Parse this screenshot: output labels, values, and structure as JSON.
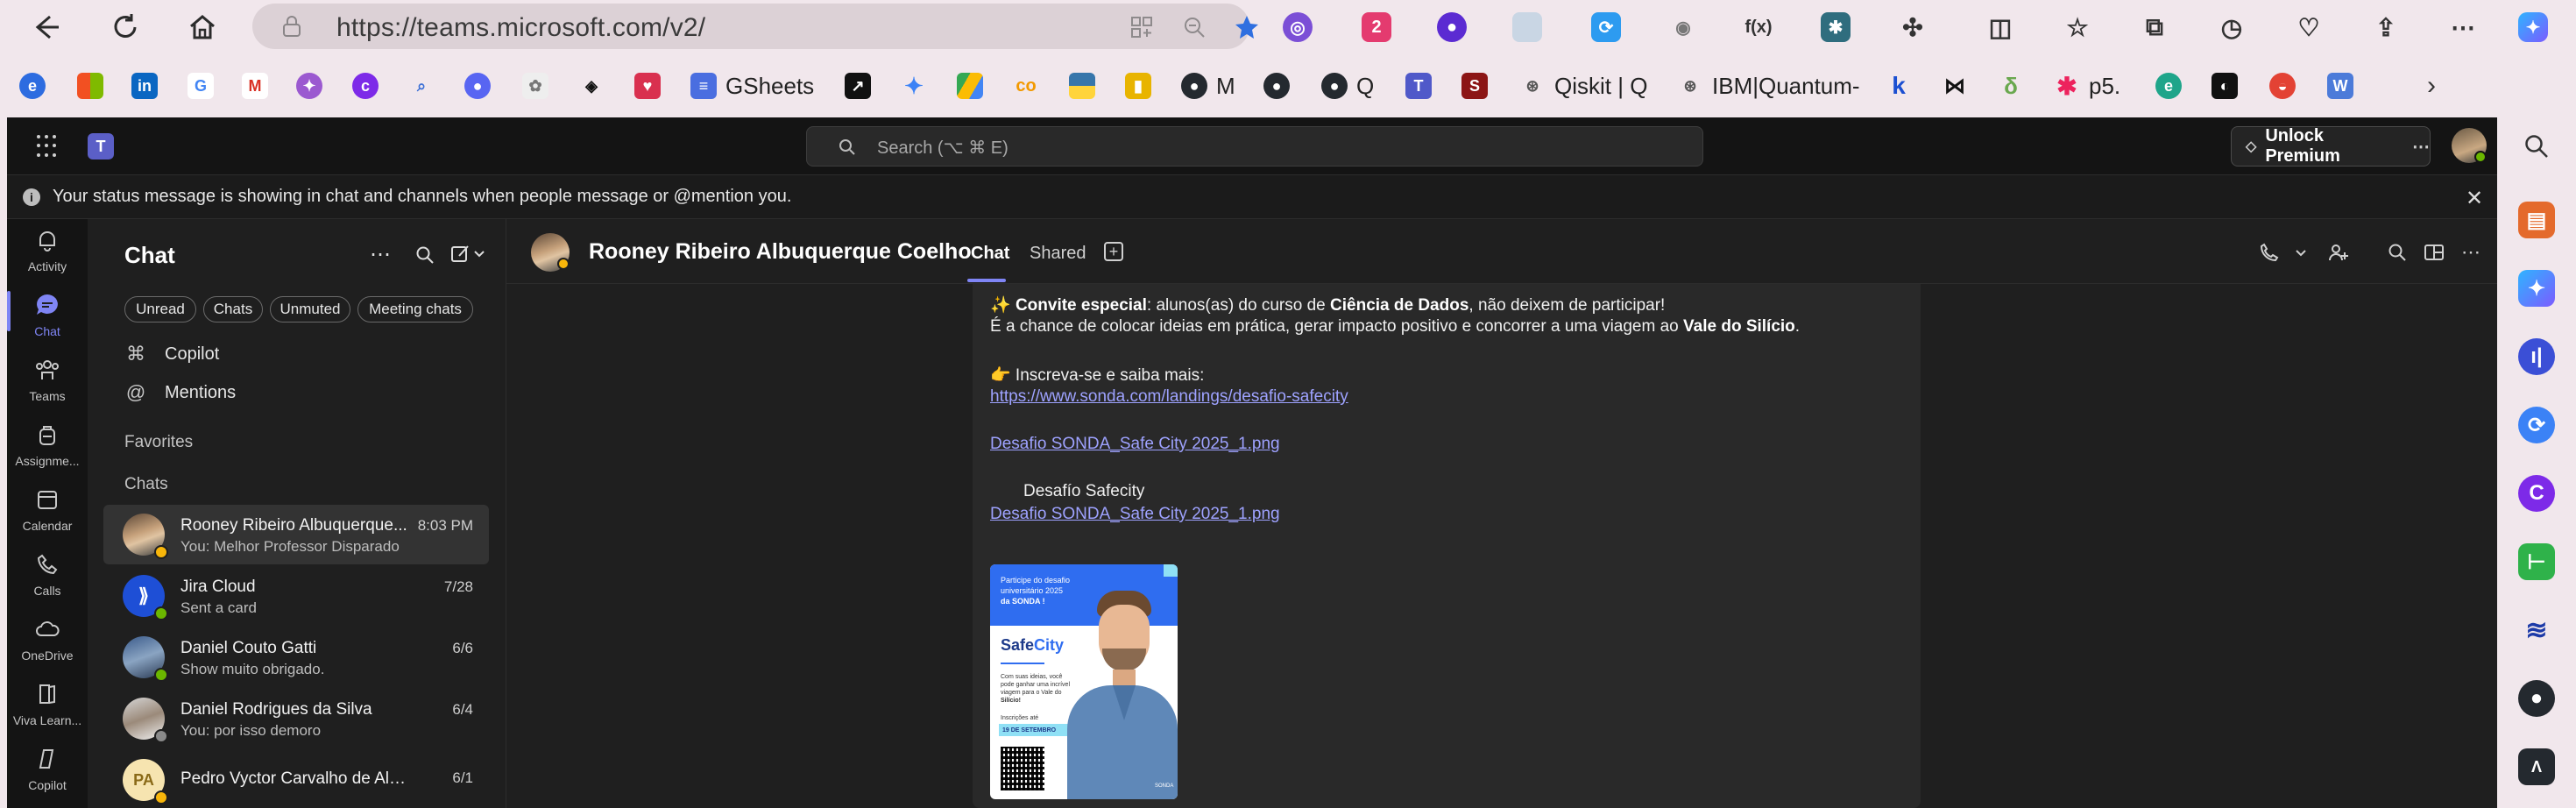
{
  "browser": {
    "url": "https://teams.microsoft.com/v2/",
    "bookmarks": [
      {
        "label": "GSheets"
      },
      {
        "label": "M"
      },
      {
        "label": "Q"
      },
      {
        "label": "Qiskit | Q"
      },
      {
        "label": "IBM|Quantum-"
      },
      {
        "label": "p5."
      }
    ]
  },
  "teams": {
    "search_placeholder": "Search (⌥ ⌘ E)",
    "premium_label": "Unlock Premium",
    "banner_text": "Your status message is showing in chat and channels when people message or @mention you.",
    "rail": [
      {
        "label": "Activity"
      },
      {
        "label": "Chat"
      },
      {
        "label": "Teams"
      },
      {
        "label": "Assignme..."
      },
      {
        "label": "Calendar"
      },
      {
        "label": "Calls"
      },
      {
        "label": "OneDrive"
      },
      {
        "label": "Viva Learn..."
      },
      {
        "label": "Copilot"
      }
    ],
    "chat_pane": {
      "title": "Chat",
      "filters": [
        "Unread",
        "Chats",
        "Unmuted",
        "Meeting chats"
      ],
      "nav": [
        {
          "label": "Copilot"
        },
        {
          "label": "Mentions"
        }
      ],
      "favorites_label": "Favorites",
      "chats_label": "Chats",
      "chats": [
        {
          "name": "Rooney Ribeiro Albuquerque...",
          "preview": "You: Melhor Professor Disparado",
          "time": "8:03 PM"
        },
        {
          "name": "Jira Cloud",
          "preview": "Sent a card",
          "time": "7/28"
        },
        {
          "name": "Daniel Couto Gatti",
          "preview": "Show muito obrigado.",
          "time": "6/6"
        },
        {
          "name": "Daniel Rodrigues da Silva",
          "preview": "You: por isso demoro",
          "time": "6/4"
        },
        {
          "name": "Pedro Vyctor Carvalho de Almeida",
          "preview": "",
          "time": "6/1",
          "initials": "PA"
        }
      ]
    },
    "conversation": {
      "name": "Rooney Ribeiro Albuquerque Coelho",
      "tabs": [
        "Chat",
        "Shared"
      ],
      "message": {
        "line1_a": "✨ ",
        "line1_b": "Convite especial",
        "line1_c": ": alunos(as) do curso de ",
        "line1_d": "Ciência de Dados",
        "line1_e": ", não deixem de participar!",
        "line2_a": "É a chance de colocar ideias em prática, gerar impacto positivo e concorrer a uma viagem ao ",
        "line2_b": "Vale do Silício",
        "line2_c": ".",
        "line3": "👉 Inscreva-se e saiba mais:",
        "link1": "https://www.sonda.com/landings/desafio-safecity",
        "link2": "Desafio SONDA_Safe City 2025_1.png",
        "attachment_title": "Desafío Safecity",
        "link3": "Desafio SONDA_Safe City 2025_1.png",
        "poster": {
          "line1": "Participe do desafio",
          "line2": "universitário 2025",
          "line3": "da SONDA !",
          "brand": "Safe",
          "brand2": "City",
          "body1": "Com suas ideias, você",
          "body2": "pode ganhar uma incrível",
          "body3": "viagem para o Vale do",
          "body4": "Silício!",
          "deadline_label": "Inscrições até",
          "deadline": "19 DE SETEMBRO"
        }
      }
    }
  }
}
